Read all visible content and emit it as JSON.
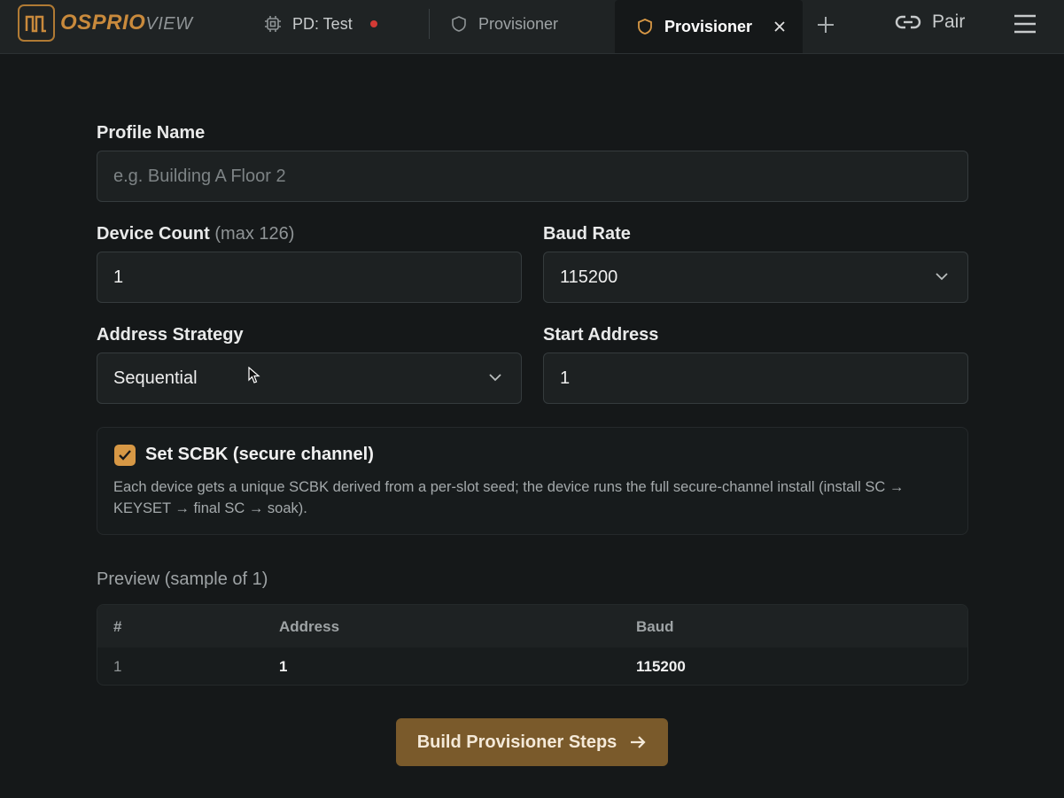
{
  "header": {
    "logo_primary": "OSPRIO",
    "logo_secondary": "VIEW",
    "tabs": [
      {
        "label": "PD: Test",
        "icon": "chip-icon",
        "status_color": "#d33a35"
      },
      {
        "label": "Provisioner",
        "icon": "shield-icon"
      },
      {
        "label": "Provisioner",
        "icon": "shield-icon",
        "active": true
      }
    ],
    "pair_label": "Pair"
  },
  "form": {
    "profile_name": {
      "label": "Profile Name",
      "placeholder": "e.g. Building A Floor 2",
      "value": ""
    },
    "device_count": {
      "label": "Device Count",
      "hint": "(max 126)",
      "value": "1"
    },
    "baud_rate": {
      "label": "Baud Rate",
      "value": "115200"
    },
    "address_strategy": {
      "label": "Address Strategy",
      "value": "Sequential"
    },
    "start_address": {
      "label": "Start Address",
      "value": "1"
    },
    "scbk": {
      "checked": true,
      "title": "Set SCBK (secure channel)",
      "description": "Each device gets a unique SCBK derived from a per-slot seed; the device runs the full secure-channel install (install SC → KEYSET → final SC → soak)."
    }
  },
  "preview": {
    "title": "Preview (sample of 1)",
    "columns": [
      "#",
      "Address",
      "Baud"
    ],
    "rows": [
      [
        "1",
        "1",
        "115200"
      ]
    ]
  },
  "build_button": "Build Provisioner Steps",
  "colors": {
    "accent": "#d79845",
    "button_bg": "#7a5a2b",
    "background": "#151819"
  }
}
